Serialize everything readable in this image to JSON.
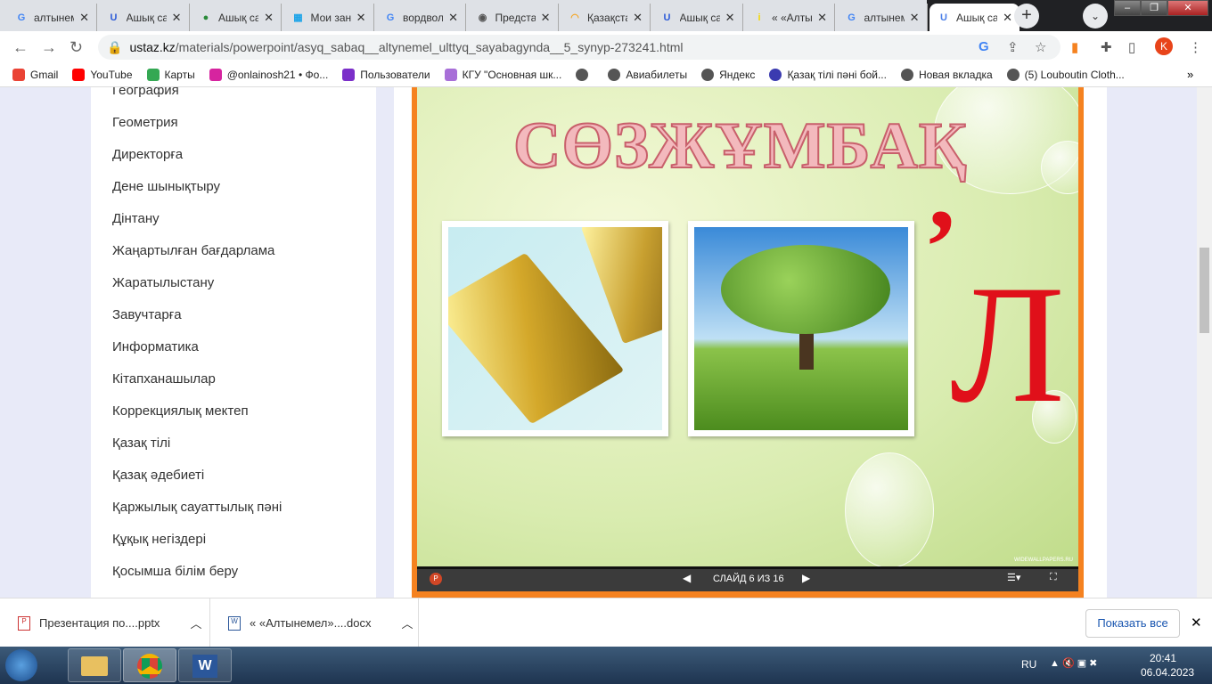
{
  "tabs": [
    {
      "title": "алтынемел",
      "icon": "G",
      "color": "#4285f4"
    },
    {
      "title": "Ашық сабақ",
      "icon": "U",
      "color": "#2d5bd8"
    },
    {
      "title": "Ашық сабақ",
      "icon": "●",
      "color": "#2a8a3a"
    },
    {
      "title": "Мои занятия",
      "icon": "▦",
      "color": "#1aa3e8"
    },
    {
      "title": "вордвол",
      "icon": "G",
      "color": "#4285f4"
    },
    {
      "title": "Представление",
      "icon": "◉",
      "color": "#555"
    },
    {
      "title": "Қазақстан",
      "icon": "◠",
      "color": "#f5a623"
    },
    {
      "title": "Ашық сабақ",
      "icon": "U",
      "color": "#2d5bd8"
    },
    {
      "title": "« «Алтынемел»",
      "icon": "i",
      "color": "#f5d800"
    },
    {
      "title": "алтынемел",
      "icon": "G",
      "color": "#4285f4"
    },
    {
      "title": "Ашық сабақ",
      "icon": "U",
      "color": "#4a7ee8",
      "active": true
    }
  ],
  "url": {
    "domain": "ustaz.kz",
    "path": "/materials/powerpoint/asyq_sabaq__altynemel_ulttyq_sayabagynda__5_synyp-273241.html"
  },
  "profile": "K",
  "bookmarks": [
    "Gmail",
    "YouTube",
    "Карты",
    "@onlainosh21 • Фо...",
    "Пользователи",
    "КГУ \"Основная шк...",
    "",
    "Авиабилеты",
    "Яндекс",
    "Қазақ тілі пәні бой...",
    "Новая вкладка",
    "(5) Louboutin Cloth..."
  ],
  "more_bookmarks": "»",
  "sidebar": [
    "География",
    "Геометрия",
    "Директорға",
    "Дене шынықтыру",
    "Дінтану",
    "Жаңартылған бағдарлама",
    "Жаратылыстану",
    "Завучтарға",
    "Информатика",
    "Кітапханашылар",
    "Коррекциялық мектеп",
    "Қазақ тілі",
    "Қазақ әдебиеті",
    "Қаржылық сауаттылық пәні",
    "Құқық негіздері",
    "Қосымша білім беру"
  ],
  "slide": {
    "title": "СӨЗЖҰМБАҚ",
    "comma": "’",
    "letter": "Л",
    "watermark": "WIDEWALLPAPERS.RU",
    "counter": "СЛАЙД 6 ИЗ 16"
  },
  "downloads": [
    {
      "name": "Презентация по....pptx",
      "type": "P"
    },
    {
      "name": "« «Алтынемел»....docx",
      "type": "W"
    }
  ],
  "show_all": "Показать все",
  "tray": {
    "lang": "RU",
    "time": "20:41",
    "date": "06.04.2023"
  }
}
